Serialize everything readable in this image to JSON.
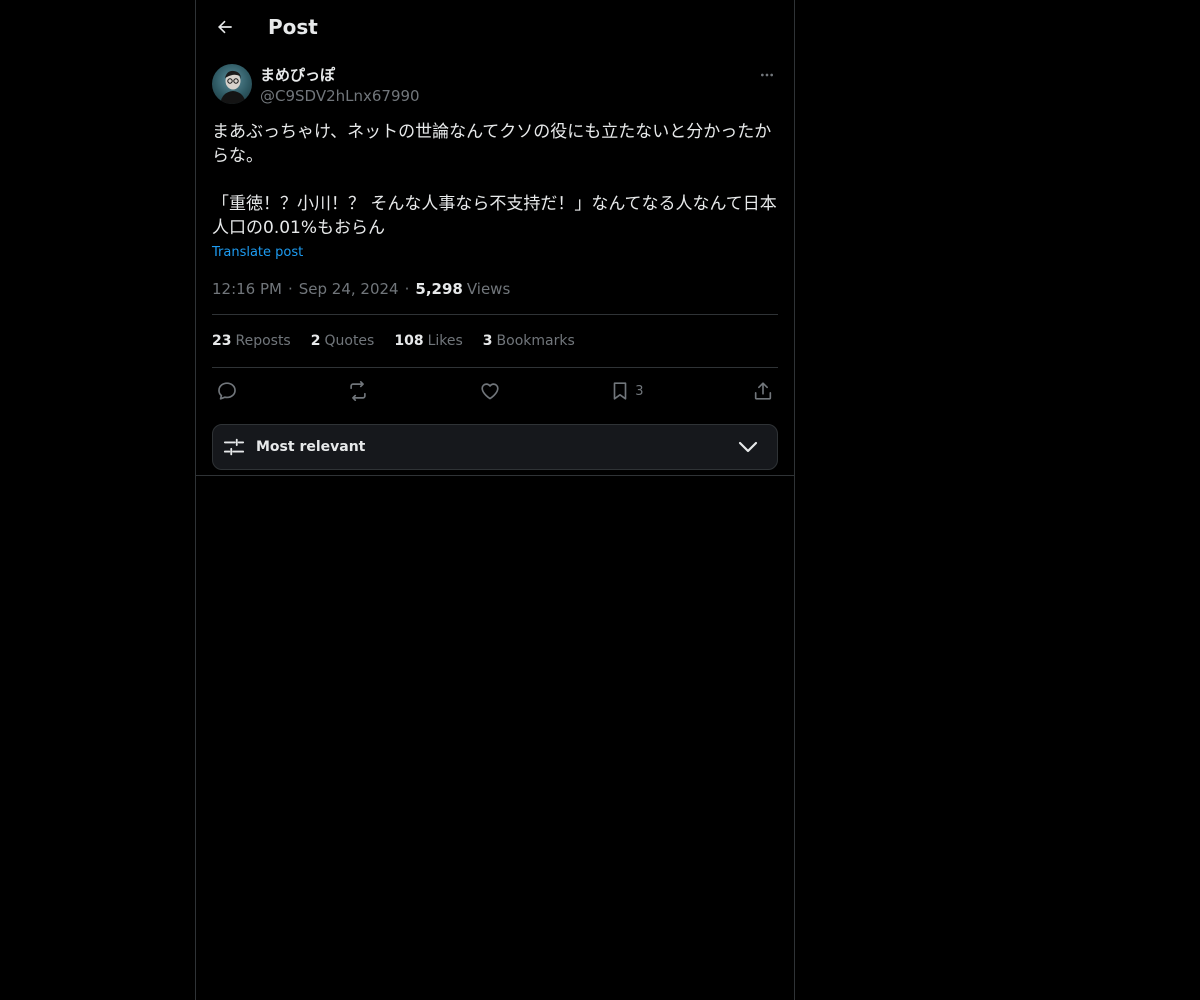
{
  "header": {
    "title": "Post",
    "back_icon": "arrow-left-icon"
  },
  "post": {
    "author": {
      "display_name": "まめぴっぽ",
      "handle": "@C9SDV2hLnx67990"
    },
    "text": "まあぶっちゃけ、ネットの世論なんてクソの役にも立たないと分かったからな。\n\n「重徳！？小川！？ そんな人事なら不支持だ！」なんてなる人なんて日本人口の0.01%もおらん",
    "translate_label": "Translate post",
    "time": "12:16 PM",
    "date": "Sep 24, 2024",
    "separator": "·",
    "views_count": "5,298",
    "views_label": "Views"
  },
  "stats": [
    {
      "count": "23",
      "label": "Reposts"
    },
    {
      "count": "2",
      "label": "Quotes"
    },
    {
      "count": "108",
      "label": "Likes"
    },
    {
      "count": "3",
      "label": "Bookmarks"
    }
  ],
  "actions": {
    "reply_icon": "reply-icon",
    "repost_icon": "repost-icon",
    "like_icon": "heart-icon",
    "bookmark_icon": "bookmark-icon",
    "bookmark_count": "3",
    "share_icon": "share-icon"
  },
  "sort": {
    "label": "Most relevant",
    "icon": "sliders-icon",
    "chevron": "chevron-down-icon"
  },
  "colors": {
    "background": "#000000",
    "text_primary": "#e7e9ea",
    "text_secondary": "#71767b",
    "accent": "#1d9bf0",
    "border": "#2f3336"
  }
}
